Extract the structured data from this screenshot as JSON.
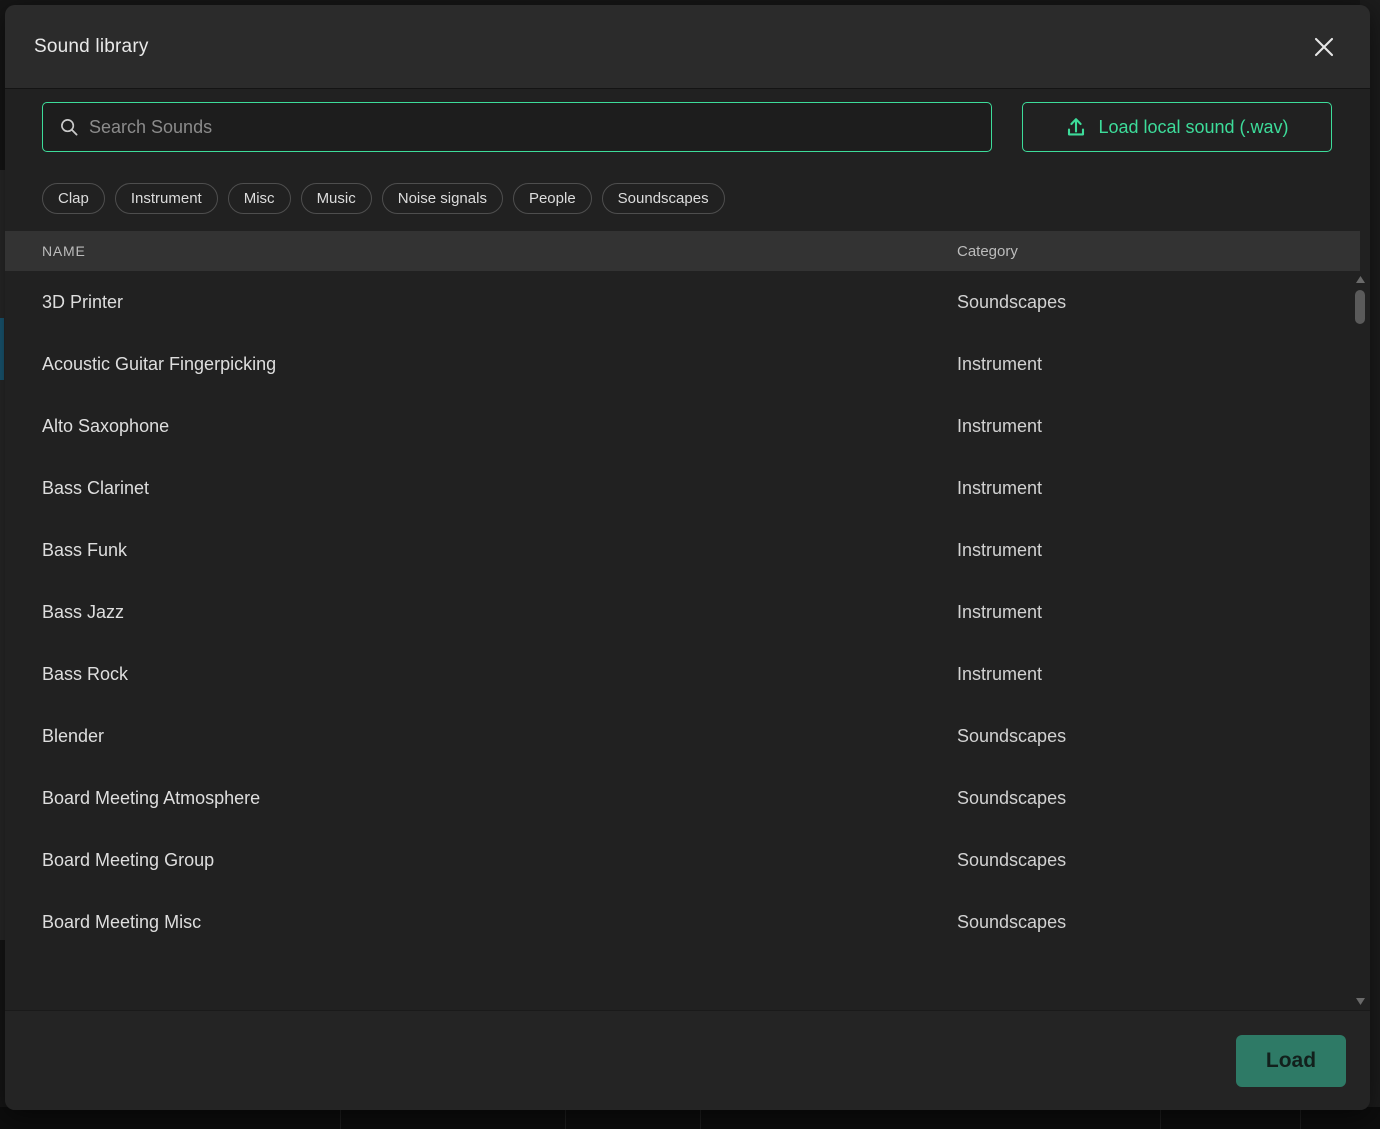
{
  "modal": {
    "title": "Sound library",
    "close_icon": "close-icon"
  },
  "search": {
    "placeholder": "Search Sounds",
    "value": "",
    "icon": "search-icon"
  },
  "load_local": {
    "label": "Load local sound (.wav)",
    "icon": "upload-icon"
  },
  "filters": [
    {
      "label": "Clap"
    },
    {
      "label": "Instrument"
    },
    {
      "label": "Misc"
    },
    {
      "label": "Music"
    },
    {
      "label": "Noise signals"
    },
    {
      "label": "People"
    },
    {
      "label": "Soundscapes"
    }
  ],
  "table": {
    "columns": [
      {
        "label": "NAME"
      },
      {
        "label": "Category"
      }
    ],
    "rows": [
      {
        "name": "3D Printer",
        "category": "Soundscapes"
      },
      {
        "name": "Acoustic Guitar Fingerpicking",
        "category": "Instrument"
      },
      {
        "name": "Alto Saxophone",
        "category": "Instrument"
      },
      {
        "name": "Bass Clarinet",
        "category": "Instrument"
      },
      {
        "name": "Bass Funk",
        "category": "Instrument"
      },
      {
        "name": "Bass Jazz",
        "category": "Instrument"
      },
      {
        "name": "Bass Rock",
        "category": "Instrument"
      },
      {
        "name": "Blender",
        "category": "Soundscapes"
      },
      {
        "name": "Board Meeting Atmosphere",
        "category": "Soundscapes"
      },
      {
        "name": "Board Meeting Group",
        "category": "Soundscapes"
      },
      {
        "name": "Board Meeting Misc",
        "category": "Soundscapes"
      }
    ]
  },
  "footer": {
    "load_label": "Load"
  },
  "colors": {
    "accent_green": "#3ddc9a",
    "load_button": "#2e7a66",
    "modal_background": "#212121",
    "header_background": "#2b2b2b",
    "table_header_background": "#333333"
  }
}
